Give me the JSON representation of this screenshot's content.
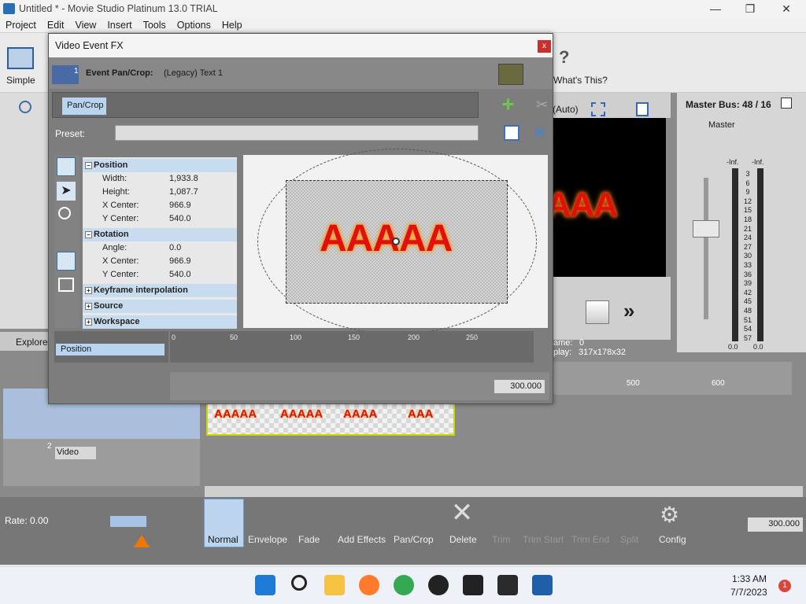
{
  "app": {
    "title": "Untitled * - Movie Studio Platinum 13.0 TRIAL"
  },
  "window_controls": [
    "—",
    "❐",
    "✕"
  ],
  "menu": [
    "Project",
    "Edit",
    "View",
    "Insert",
    "Tools",
    "Options",
    "Help"
  ],
  "toolbar": {
    "simple_label": "Simple",
    "whats_this_label": "What's This?",
    "auto_label": "(Auto)"
  },
  "dialog": {
    "title": "Video Event FX",
    "close": "x",
    "track_number": "1",
    "event_label": "Event Pan/Crop:",
    "event_value": "(Legacy) Text 1",
    "chain_label": "Pan/Crop",
    "preset_label": "Preset:",
    "sections": {
      "position": "Position",
      "rotation": "Rotation",
      "keyframe": "Keyframe interpolation",
      "source": "Source",
      "workspace": "Workspace"
    },
    "props": {
      "width_k": "Width:",
      "width_v": "1,933.8",
      "height_k": "Height:",
      "height_v": "1,087.7",
      "xc_k": "X Center:",
      "xc_v": "966.9",
      "yc_k": "Y Center:",
      "yc_v": "540.0",
      "angle_k": "Angle:",
      "angle_v": "0.0",
      "rxc_k": "X Center:",
      "rxc_v": "966.9",
      "ryc_k": "Y Center:",
      "ryc_v": "540.0"
    },
    "preview_text": "AAAAA",
    "ruler_ticks": [
      "0",
      "50",
      "100",
      "150",
      "200",
      "250"
    ],
    "keyframe_track": "Position",
    "time_value": "300.000"
  },
  "master": {
    "label": "Master Bus: 48 / 16",
    "track": "Master",
    "inf1": "-Inf.",
    "inf2": "-Inf.",
    "scale": [
      "3",
      "6",
      "9",
      "12",
      "15",
      "18",
      "21",
      "24",
      "27",
      "30",
      "33",
      "36",
      "39",
      "42",
      "45",
      "48",
      "51",
      "54",
      "57"
    ],
    "bottom1": "0.0",
    "bottom2": "0.0"
  },
  "preview": {
    "text": "AAA",
    "frame_label": "ame:",
    "frame_value": "0",
    "display_label": "play:",
    "display_value": "317x178x32"
  },
  "explorer": "Explorer",
  "timeline": {
    "track1_clips": [
      "AAAAA",
      "AAAAA",
      "AAAA",
      "AAA"
    ],
    "track2_number": "2",
    "track2_name": "Video",
    "marks": [
      "500",
      "600"
    ]
  },
  "bottom": {
    "rate": "Rate: 0.00",
    "tools": [
      "Normal",
      "Envelope",
      "Fade",
      "Add Effects",
      "Pan/Crop",
      "Delete",
      "Trim",
      "Trim Start",
      "Trim End",
      "Split",
      "Config"
    ],
    "time": "300.000"
  },
  "taskbar": {
    "time": "1:33 AM",
    "date": "7/7/2023",
    "badge": "1"
  },
  "colors": {
    "accent": "#c8dcf0",
    "clip": "#c8d800",
    "text_red": "#e01010"
  }
}
